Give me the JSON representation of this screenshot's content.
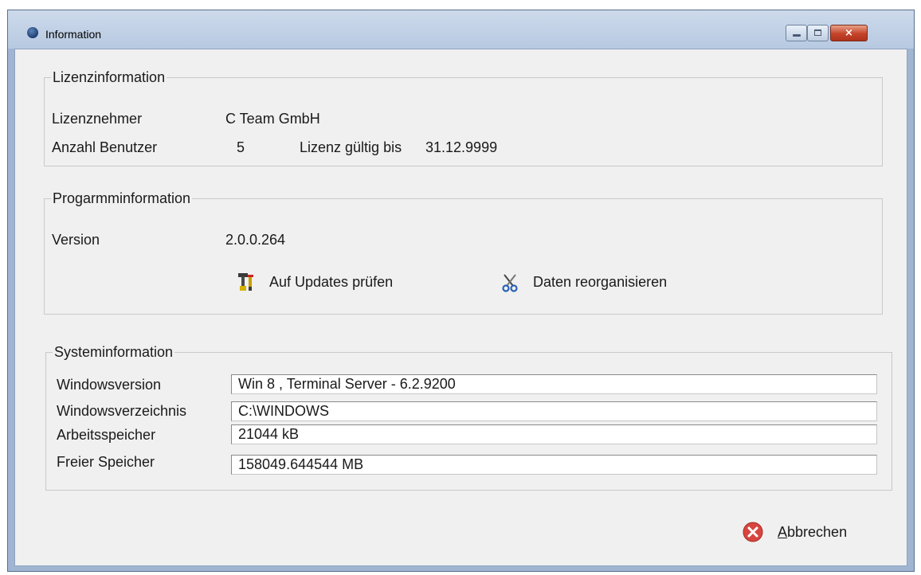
{
  "window": {
    "title": "Information",
    "close_glyph": "×"
  },
  "license": {
    "heading": "Lizenzinformation",
    "licensee_label": "Lizenznehmer",
    "licensee_value": "C Team GmbH",
    "users_label": "Anzahl Benutzer",
    "users_value": "5",
    "valid_label": "Lizenz gültig bis",
    "valid_value": "31.12.9999"
  },
  "program": {
    "heading": "Progarmminformation",
    "version_label": "Version",
    "version_value": "2.0.0.264",
    "update_button": "Auf Updates prüfen",
    "reorg_button": "Daten reorganisieren"
  },
  "system": {
    "heading": "Systeminformation",
    "rows": [
      {
        "label": "Windowsversion",
        "value": "Win 8 , Terminal Server - 6.2.9200"
      },
      {
        "label": "Windowsverzeichnis",
        "value": "C:\\WINDOWS"
      },
      {
        "label": "Arbeitsspeicher",
        "value": "21044 kB"
      },
      {
        "label": "Freier Speicher",
        "value": "158049.644544 MB"
      }
    ]
  },
  "footer": {
    "cancel_accel": "A",
    "cancel_rest": "bbrechen"
  },
  "icons": {
    "app": "app-globe-icon",
    "update": "update-tools-icon",
    "reorg": "scissors-icon",
    "cancel": "cancel-x-circle-icon"
  },
  "colors": {
    "frame": "#9fb5d2",
    "client": "#f0f0f0",
    "close_button": "#c4442a",
    "cancel_icon": "#d8453f"
  }
}
